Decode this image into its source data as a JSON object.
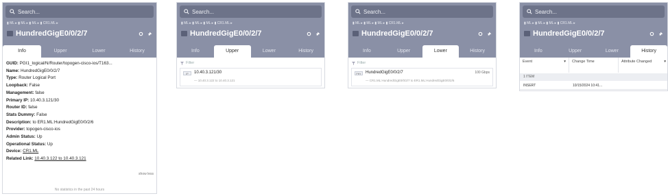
{
  "common": {
    "search_placeholder": "Search...",
    "breadcrumb": "▮ ML ▸ ▮ ML ▸ ▮ ML ▸ ▮ CR1.ML ▸",
    "title": "HundredGigE0/0/2/7",
    "tabs": [
      "Info",
      "Upper",
      "Lower",
      "History"
    ]
  },
  "panel1": {
    "active_tab": "Info",
    "fields": [
      {
        "label": "GUID:",
        "value": "PGI1_logical/N/Router/topogen-cisco-ios/T163..."
      },
      {
        "label": "Name:",
        "value": "HundredGigE0/0/2/7"
      },
      {
        "label": "Type:",
        "value": "Router Logical Port"
      },
      {
        "label": "Loopback:",
        "value": "False"
      },
      {
        "label": "Management:",
        "value": "false"
      },
      {
        "label": "Primary IP:",
        "value": "10.40.3.121/30"
      },
      {
        "label": "Router ID:",
        "value": "false"
      },
      {
        "label": "Stats Dummy:",
        "value": "False"
      },
      {
        "label": "Description:",
        "value": "to ER1.ML:HundredGigE0/0/2/6"
      },
      {
        "label": "Provider:",
        "value": "topogen-cisco-ios"
      },
      {
        "label": "Admin Status:",
        "value": "Up"
      },
      {
        "label": "Operational Status:",
        "value": "Up"
      },
      {
        "label": "Device:",
        "value": "CR1.ML"
      },
      {
        "label": "Related Link:",
        "value": "10.40.3.122 to 10.40.3.121"
      }
    ],
    "show_less": "show less",
    "no_stats": "No statistics in the past 24 hours"
  },
  "panel2": {
    "active_tab": "Upper",
    "filter_placeholder": "Filter",
    "item": {
      "chip": "IP",
      "name": "10.40.3.121/30",
      "sub": "— 10.40.3.122 to 10.40.3.121"
    }
  },
  "panel3": {
    "active_tab": "Lower",
    "filter_placeholder": "Filter",
    "item": {
      "chip": "PHY",
      "name": "HundredGigE0/0/2/7",
      "right": "100 Gbps",
      "sub": "— CR1.ML:HundredGigE0/0/2/7 to ER1.ML:HundredGigE0/0/2/6"
    }
  },
  "panel4": {
    "active_tab": "History",
    "columns": [
      "Event",
      "Change Time",
      "Attribute Changed"
    ],
    "group": "1 ITEM",
    "row": {
      "event": "INSERT",
      "time": "10/15/2024 10:41..."
    }
  },
  "colors": {
    "header": "#8a90a6",
    "search": "#6d7389",
    "accent": "#5b6178"
  }
}
